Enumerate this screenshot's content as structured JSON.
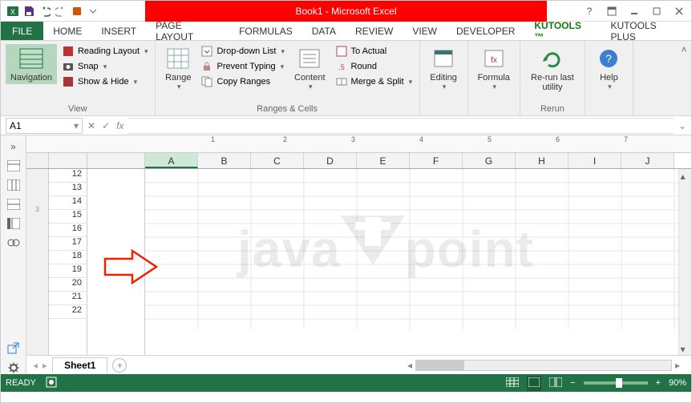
{
  "title": "Book1 - Microsoft Excel",
  "tabs": {
    "file": "FILE",
    "list": [
      "HOME",
      "INSERT",
      "PAGE LAYOUT",
      "FORMULAS",
      "DATA",
      "REVIEW",
      "VIEW",
      "DEVELOPER",
      "KUTOOLS ™",
      "KUTOOLS PLUS"
    ],
    "active": "KUTOOLS ™"
  },
  "ribbon": {
    "view": {
      "nav": "Navigation",
      "reading": "Reading Layout",
      "snap": "Snap",
      "showhide": "Show & Hide",
      "group": "View"
    },
    "ranges": {
      "range": "Range",
      "ddlist": "Drop-down List",
      "prevent": "Prevent Typing",
      "copy": "Copy Ranges",
      "content": "Content",
      "actual": "To Actual",
      "round": "Round",
      "merge": "Merge & Split",
      "group": "Ranges & Cells"
    },
    "editing": "Editing",
    "formula": "Formula",
    "rerun": "Re-run last utility",
    "rerung": "Rerun",
    "help": "Help"
  },
  "namebox": "A1",
  "fx": "fx",
  "columns": [
    "A",
    "B",
    "C",
    "D",
    "E",
    "F",
    "G",
    "H",
    "I",
    "J"
  ],
  "rows": [
    "12",
    "13",
    "14",
    "15",
    "16",
    "17",
    "18",
    "19",
    "20",
    "21",
    "22"
  ],
  "sheet": "Sheet1",
  "status": "READY",
  "zoom": "90%",
  "watermark": {
    "t1": "java",
    "t2": "t",
    "t3": "point"
  }
}
